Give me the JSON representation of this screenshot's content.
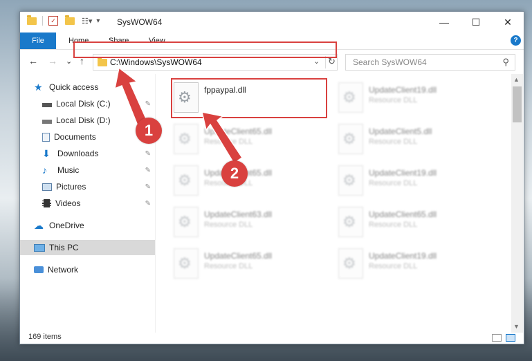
{
  "window": {
    "title": "SysWOW64",
    "minimize_glyph": "—",
    "maximize_glyph": "☐",
    "close_glyph": "✕"
  },
  "ribbon": {
    "file": "File",
    "home": "Home",
    "share": "Share",
    "view": "View",
    "help_glyph": "?"
  },
  "nav": {
    "back_glyph": "←",
    "forward_glyph": "→",
    "recent_glyph": "⌄",
    "up_glyph": "↑",
    "address": "C:\\Windows\\SysWOW64",
    "dropdown_glyph": "⌄",
    "refresh_glyph": "↻",
    "search_placeholder": "Search SysWOW64",
    "search_glyph": "⚲"
  },
  "sidebar": {
    "items": [
      {
        "label": "Quick access",
        "icon": "star-icon"
      },
      {
        "label": "Local Disk (C:)",
        "icon": "drive-icon"
      },
      {
        "label": "Local Disk (D:)",
        "icon": "drive-icon"
      },
      {
        "label": "Documents",
        "icon": "documents-icon"
      },
      {
        "label": "Downloads",
        "icon": "downloads-icon"
      },
      {
        "label": "Music",
        "icon": "music-icon"
      },
      {
        "label": "Pictures",
        "icon": "pictures-icon"
      },
      {
        "label": "Videos",
        "icon": "videos-icon"
      },
      {
        "label": "OneDrive",
        "icon": "cloud-icon"
      },
      {
        "label": "This PC",
        "icon": "pc-icon"
      },
      {
        "label": "Network",
        "icon": "network-icon"
      }
    ],
    "pin_glyph": "📌"
  },
  "files": [
    {
      "name": "fppaypal.dll",
      "type": ""
    },
    {
      "name": "UpdateClient19.dll",
      "type": "Resource DLL"
    },
    {
      "name": "UpdateClient65.dll",
      "type": "Resource DLL"
    },
    {
      "name": "UpdateClient5.dll",
      "type": "Resource DLL"
    },
    {
      "name": "UpdateClient65.dll",
      "type": "Resource DLL"
    },
    {
      "name": "UpdateClient19.dll",
      "type": "Resource DLL"
    },
    {
      "name": "UpdateClient63.dll",
      "type": "Resource DLL"
    },
    {
      "name": "UpdateClient65.dll",
      "type": "Resource DLL"
    },
    {
      "name": "UpdateClient65.dll",
      "type": "Resource DLL"
    },
    {
      "name": "UpdateClient19.dll",
      "type": "Resource DLL"
    }
  ],
  "status": {
    "item_count": "169 items"
  },
  "annotations": {
    "step1": "1",
    "step2": "2",
    "color": "#d9413f"
  },
  "scroll": {
    "up_glyph": "▲",
    "down_glyph": "▼"
  }
}
